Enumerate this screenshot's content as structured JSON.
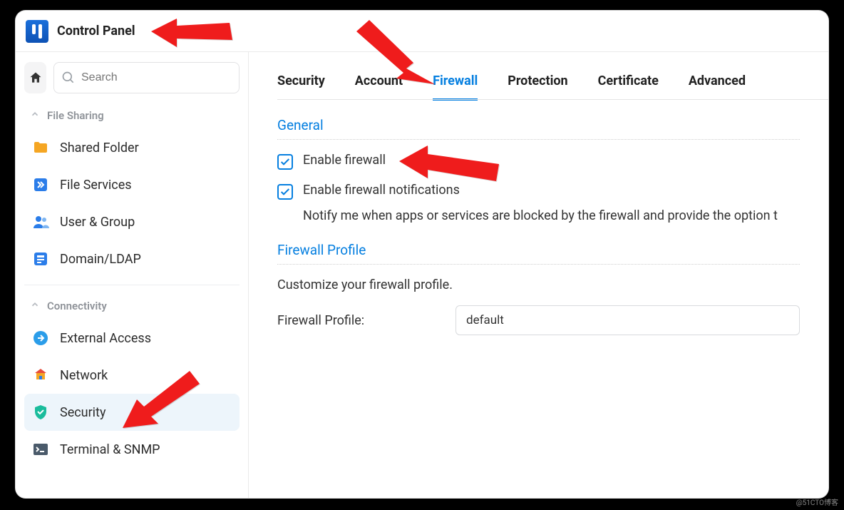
{
  "window": {
    "title": "Control Panel"
  },
  "search": {
    "placeholder": "Search"
  },
  "sidebar": {
    "groups": [
      {
        "label": "File Sharing",
        "items": [
          {
            "label": "Shared Folder"
          },
          {
            "label": "File Services"
          },
          {
            "label": "User & Group"
          },
          {
            "label": "Domain/LDAP"
          }
        ]
      },
      {
        "label": "Connectivity",
        "items": [
          {
            "label": "External Access"
          },
          {
            "label": "Network"
          },
          {
            "label": "Security"
          },
          {
            "label": "Terminal & SNMP"
          }
        ]
      }
    ]
  },
  "tabs": {
    "items": [
      "Security",
      "Account",
      "Firewall",
      "Protection",
      "Certificate",
      "Advanced"
    ],
    "active": "Firewall"
  },
  "firewall": {
    "general_title": "General",
    "enable_label": "Enable firewall",
    "enable_checked": true,
    "notify_label": "Enable firewall notifications",
    "notify_checked": true,
    "notify_desc": "Notify me when apps or services are blocked by the firewall and provide the option t",
    "profile_title": "Firewall Profile",
    "profile_desc": "Customize your firewall profile.",
    "profile_label": "Firewall Profile:",
    "profile_value": "default"
  },
  "watermark": "@51CTO博客"
}
